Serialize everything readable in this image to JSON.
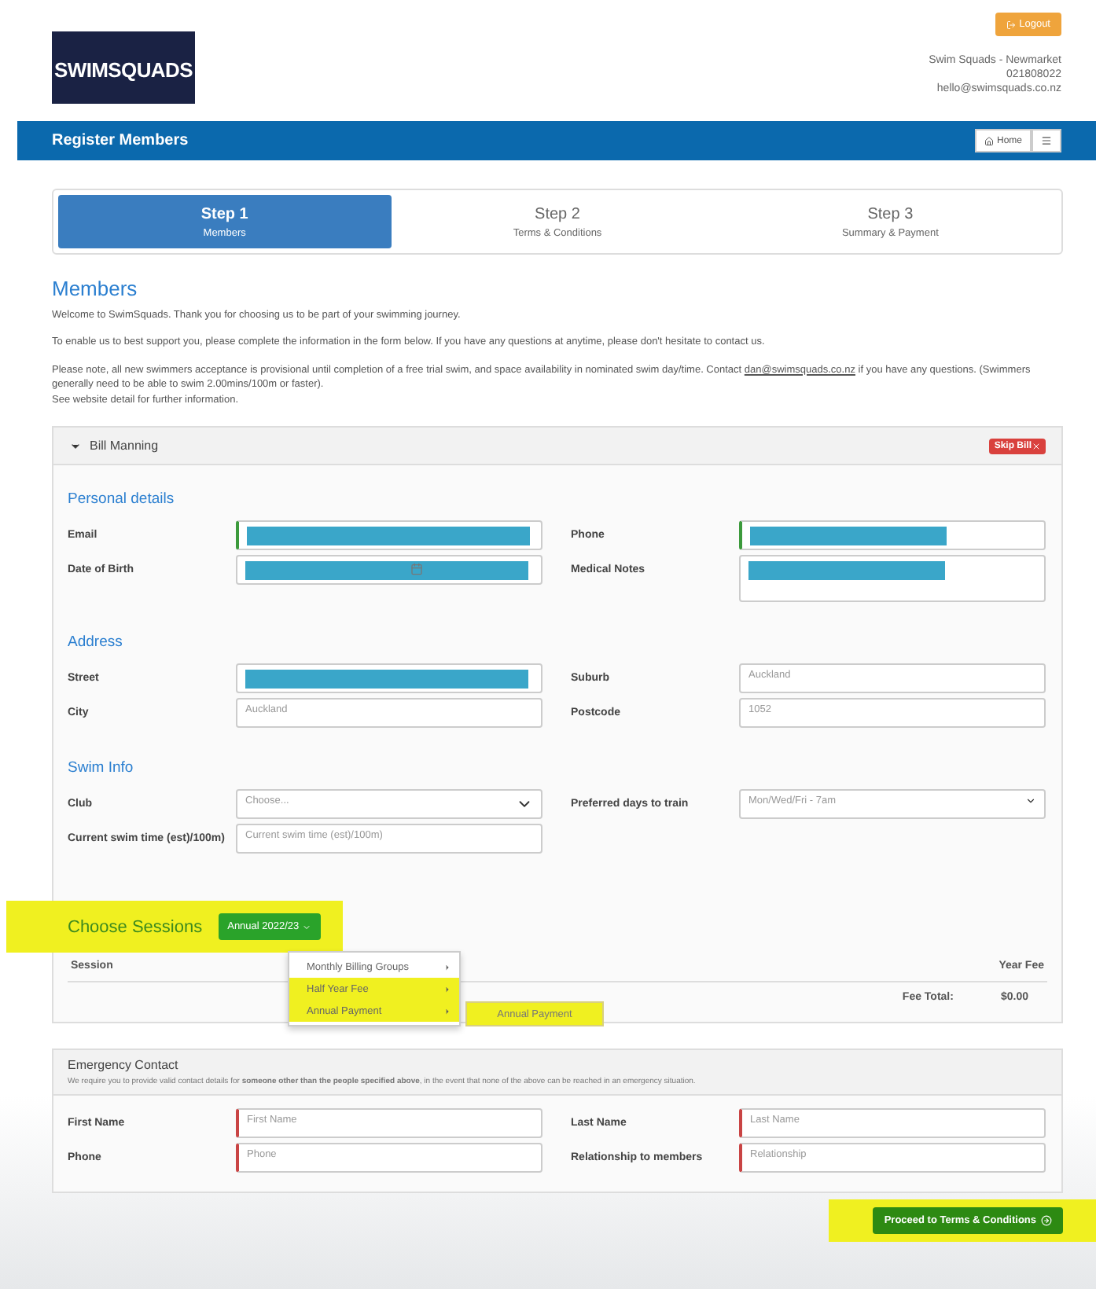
{
  "header": {
    "logo_text": "SWIMSQUADS",
    "logout": "Logout",
    "contact": [
      "Swim Squads - Newmarket",
      "021808022",
      "hello@swimsquads.co.nz"
    ]
  },
  "navbar": {
    "title": "Register Members",
    "home": "Home"
  },
  "steps": [
    {
      "title": "Step 1",
      "subtitle": "Members",
      "selected": true
    },
    {
      "title": "Step 2",
      "subtitle": "Terms & Conditions",
      "selected": false
    },
    {
      "title": "Step 3",
      "subtitle": "Summary & Payment",
      "selected": false
    }
  ],
  "intro": {
    "heading": "Members",
    "paragraphs": [
      "Welcome to SwimSquads. Thank you for choosing us to be part of your swimming journey.",
      "To enable us to best support you, please complete the information in the form below. If you have any questions at anytime, please don't hesitate to contact us."
    ],
    "note": {
      "text": "Please note, all new swimmers acceptance is provisional until completion of a free trial swim, and space availability in nominated swim day/time. Contact",
      "link": "dan@swimsquads.co.nz",
      "after": " if you have any questions. (Swimmers generally need to be able to swim 2.00mins/100m or faster).",
      "last": "See website detail for further information."
    }
  },
  "member": {
    "name": "Bill Manning",
    "expanded": true,
    "skip": "Skip Bill",
    "sections": [
      {
        "title": "Personal details",
        "fields": [
          {
            "label": "Email",
            "kind": "input",
            "redacted": true,
            "valid": true,
            "invalid": false
          },
          {
            "label": "Phone",
            "kind": "input",
            "redacted": true,
            "valid": true,
            "invalid": false
          },
          {
            "label": "Date of Birth",
            "kind": "date",
            "redacted": true,
            "valid": false,
            "invalid": false
          },
          {
            "label": "Medical Notes",
            "kind": "textarea",
            "redacted": true,
            "valid": false,
            "invalid": false
          }
        ]
      },
      {
        "title": "Address",
        "fields": [
          {
            "label": "Street",
            "kind": "input",
            "redacted": true,
            "valid": false,
            "invalid": false
          },
          {
            "label": "Suburb",
            "kind": "input",
            "placeholder": "Auckland",
            "valid": false,
            "invalid": false
          },
          {
            "label": "City",
            "kind": "input",
            "placeholder": "Auckland",
            "valid": false,
            "invalid": false
          },
          {
            "label": "Postcode",
            "kind": "input",
            "placeholder": "1052",
            "valid": false,
            "invalid": false
          }
        ]
      },
      {
        "title": "Swim Info",
        "fields": [
          {
            "label": "Club",
            "kind": "select",
            "placeholder": "Choose...",
            "valid": false,
            "invalid": false
          },
          {
            "label": "Preferred days to train",
            "kind": "dropdown",
            "placeholder": "Mon/Wed/Fri - 7am",
            "valid": false,
            "invalid": false
          },
          {
            "label": "Current swim time (est)/100m)",
            "kind": "input",
            "placeholder": "Current swim time (est)/100m)",
            "valid": false,
            "invalid": false
          }
        ]
      }
    ],
    "sessions": {
      "title": "Choose Sessions",
      "highlighted": true,
      "dropdown": "Annual 2022/23",
      "columns": [
        "Session",
        "Year Fee"
      ],
      "fee_label": "Fee Total:",
      "fee_total": "$0.00",
      "menu": [
        {
          "label": "Monthly Billing Groups",
          "highlighted": false
        },
        {
          "label": "Half Year Fee",
          "highlighted": true
        },
        {
          "label": "Annual Payment",
          "highlighted": true
        }
      ],
      "submenu": {
        "label": "Annual Payment",
        "highlighted": true
      }
    }
  },
  "emergency": {
    "title": "Emergency Contact",
    "description": "We require you to provide valid contact details for **someone other than the people specified above**, in the event that none of the above can be reached in an emergency situation.",
    "fields": [
      {
        "label": "First Name",
        "kind": "input",
        "placeholder": "First Name",
        "valid": false,
        "invalid": true
      },
      {
        "label": "Last Name",
        "kind": "input",
        "placeholder": "Last Name",
        "valid": false,
        "invalid": true
      },
      {
        "label": "Phone",
        "kind": "input",
        "placeholder": "Phone",
        "valid": false,
        "invalid": true
      },
      {
        "label": "Relationship to members",
        "kind": "input",
        "placeholder": "Relationship",
        "valid": false,
        "invalid": true
      }
    ]
  },
  "proceed": {
    "label": "Proceed to Terms & Conditions",
    "highlighted": true
  }
}
